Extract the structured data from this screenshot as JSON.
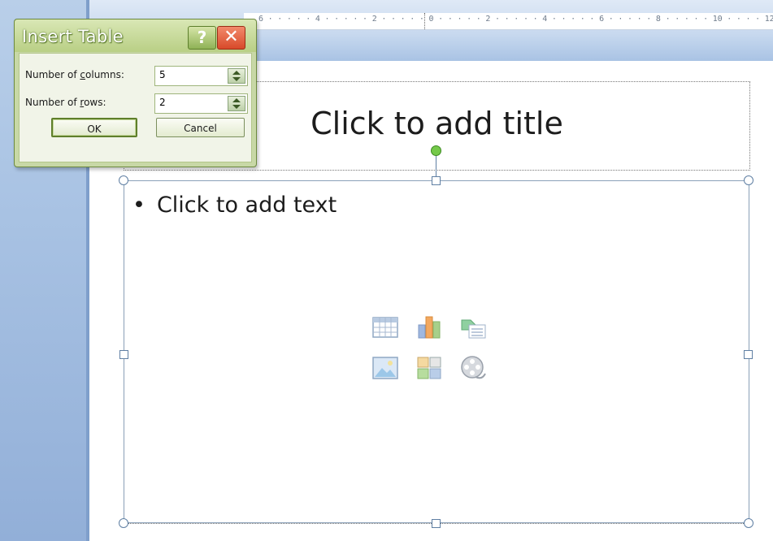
{
  "ruler": {
    "text": "6 · · · · · 4 · · · · · 2 · · · · · 0 · · · · · 2 · · · · · 4 · · · · · 6 · · · · · 8 · · · · · 10 · · · · 12"
  },
  "slide": {
    "title_placeholder": "Click to add title",
    "bullet": "•",
    "content_placeholder": "Click to add text"
  },
  "content_icons": [
    {
      "name": "insert-table-icon"
    },
    {
      "name": "insert-chart-icon"
    },
    {
      "name": "insert-smartart-icon"
    },
    {
      "name": "insert-picture-icon"
    },
    {
      "name": "insert-clipart-icon"
    },
    {
      "name": "insert-media-icon"
    }
  ],
  "dialog": {
    "title": "Insert Table",
    "help_label": "?",
    "close_label": "✕",
    "columns_label_pre": "Number of ",
    "columns_label_key": "c",
    "columns_label_post": "olumns:",
    "columns_value": "5",
    "rows_label_pre": "Number of ",
    "rows_label_key": "r",
    "rows_label_post": "ows:",
    "rows_value": "2",
    "ok_label": "OK",
    "cancel_label": "Cancel"
  },
  "colors": {
    "dialog_frame": "#c8d8a6",
    "close_button": "#d84a2a",
    "rotation_handle": "#75c94a"
  }
}
